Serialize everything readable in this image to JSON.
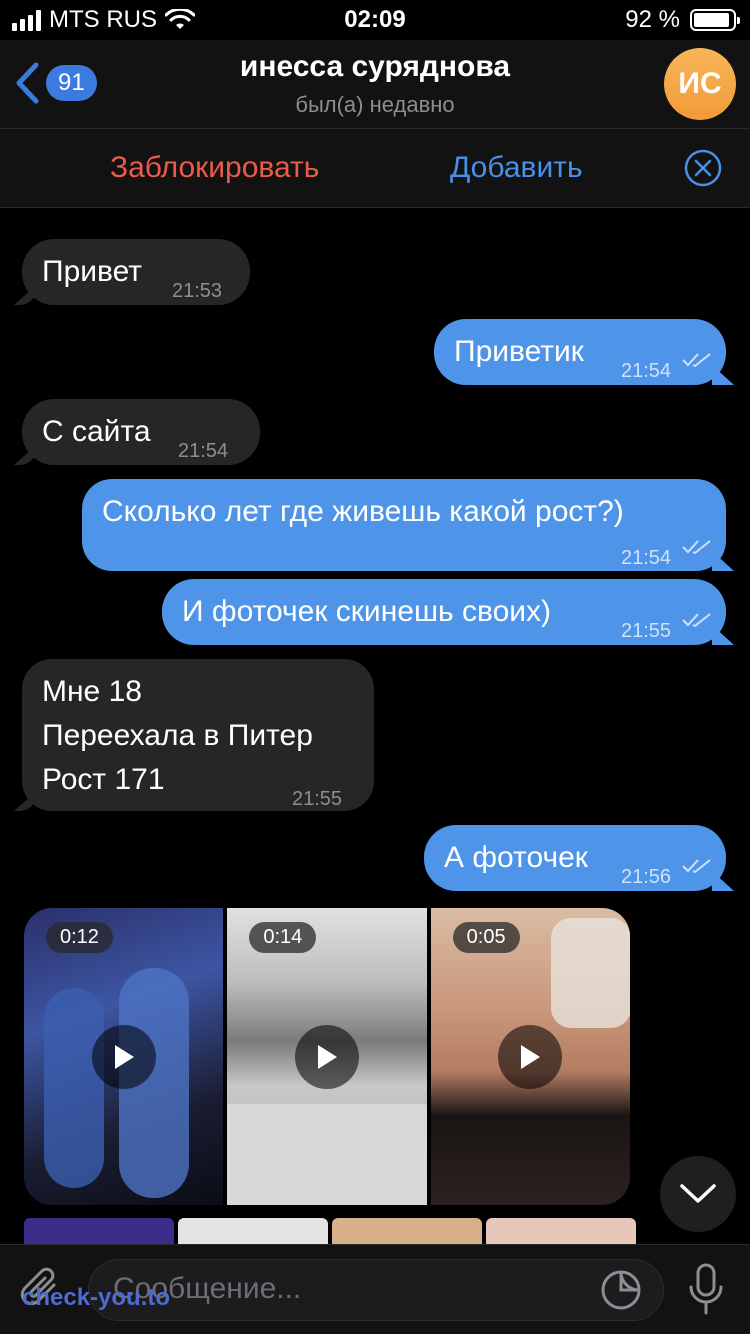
{
  "status_bar": {
    "carrier": "MTS RUS",
    "time": "02:09",
    "battery": "92 %",
    "battery_level": 0.92
  },
  "header": {
    "back_count": "91",
    "title": "инесса суряднова",
    "subtitle": "был(а) недавно",
    "avatar_initials": "ИС",
    "avatar_color": "#f2a03c"
  },
  "action_bar": {
    "block_label": "Заблокировать",
    "add_label": "Добавить"
  },
  "messages": [
    {
      "dir": "in",
      "text": "Привет",
      "time": "21:53"
    },
    {
      "dir": "out",
      "text": "Приветик",
      "time": "21:54",
      "read": true
    },
    {
      "dir": "in",
      "text": "С сайта",
      "time": "21:54"
    },
    {
      "dir": "out",
      "text": "Сколько лет где живешь какой рост?)",
      "time": "21:54",
      "read": true
    },
    {
      "dir": "out",
      "text": "И фоточек скинешь своих)",
      "time": "21:55",
      "read": true
    },
    {
      "dir": "in",
      "text": "Мне 18\nПереехала в Питер\nРост 171",
      "time": "21:55"
    },
    {
      "dir": "out",
      "text": "А фоточек",
      "time": "21:56",
      "read": true
    }
  ],
  "media": [
    {
      "duration": "0:12"
    },
    {
      "duration": "0:14"
    },
    {
      "duration": "0:05"
    }
  ],
  "input": {
    "placeholder": "Сообщение..."
  },
  "watermark": "check-you.to",
  "colors": {
    "outgoing": "#4e94e8",
    "incoming": "#262628",
    "danger": "#ec5a4a",
    "accent": "#4a8fe8"
  }
}
